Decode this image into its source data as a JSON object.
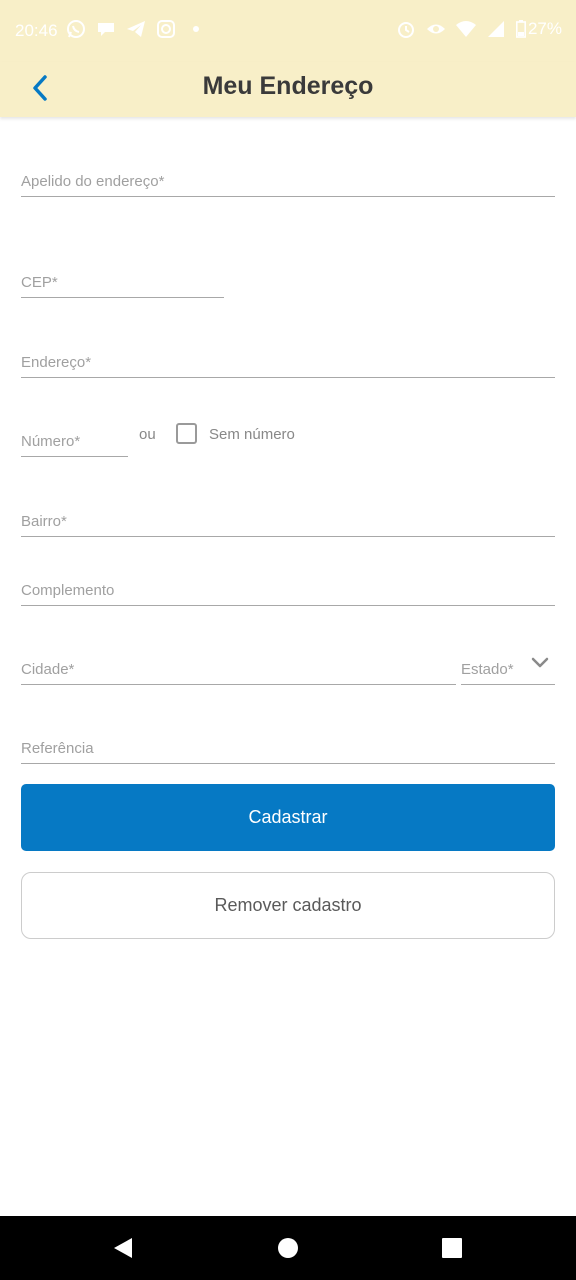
{
  "status_bar": {
    "time": "20:46",
    "battery": "27%",
    "left_icons": [
      "whatsapp-icon",
      "chat-bubble-icon",
      "telegram-icon",
      "instagram-icon",
      "dot-icon"
    ],
    "right_icons": [
      "alarm-icon",
      "eye-icon",
      "wifi-icon",
      "signal-icon",
      "battery-icon"
    ]
  },
  "header": {
    "title": "Meu Endereço",
    "back_icon": "chevron-left-icon",
    "background": "#f8efc8",
    "accent": "#0679c4"
  },
  "form": {
    "nickname": {
      "placeholder": "Apelido do endereço*",
      "value": ""
    },
    "cep": {
      "placeholder": "CEP*",
      "value": ""
    },
    "address": {
      "placeholder": "Endereço*",
      "value": ""
    },
    "number": {
      "placeholder": "Número*",
      "value": ""
    },
    "or_text": "ou",
    "no_number_label": "Sem número",
    "no_number_checked": false,
    "neighborhood": {
      "placeholder": "Bairro*",
      "value": ""
    },
    "complement": {
      "placeholder": "Complemento",
      "value": ""
    },
    "city": {
      "placeholder": "Cidade*",
      "value": ""
    },
    "state": {
      "placeholder": "Estado*",
      "value": ""
    },
    "reference": {
      "placeholder": "Referência",
      "value": ""
    }
  },
  "actions": {
    "submit_label": "Cadastrar",
    "remove_label": "Remover cadastro",
    "primary_color": "#0679c4"
  },
  "nav_bar": {
    "icons": [
      "back-triangle-icon",
      "home-circle-icon",
      "recents-square-icon"
    ]
  }
}
